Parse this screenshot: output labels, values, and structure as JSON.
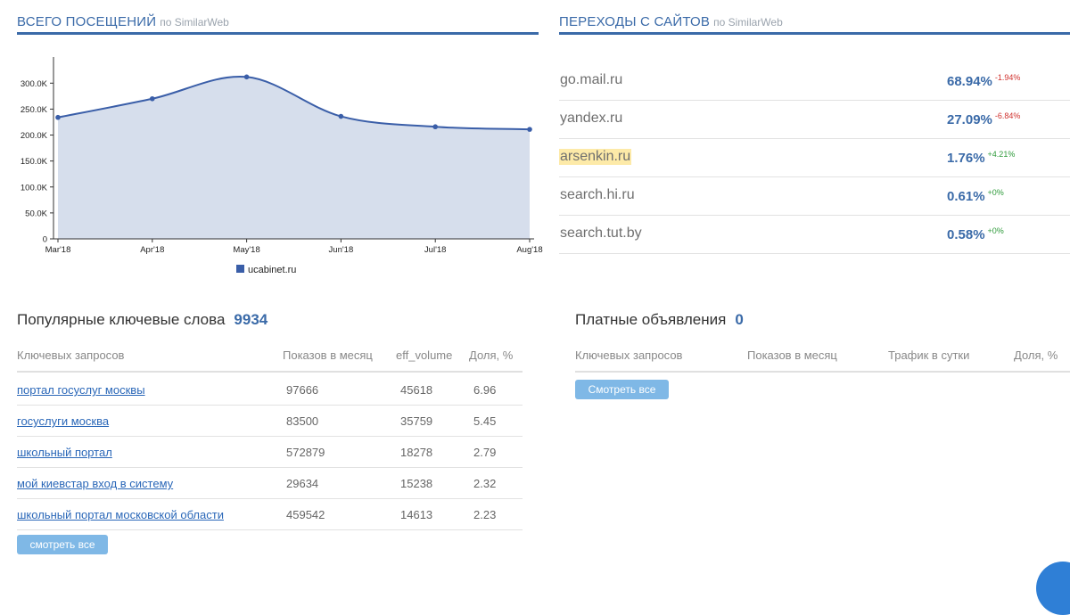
{
  "visits": {
    "title": "ВСЕГО ПОСЕЩЕНИЙ",
    "source": "по SimilarWeb",
    "legend_label": "ucabinet.ru",
    "color": "#3a5ea8"
  },
  "chart_data": {
    "type": "area",
    "x": [
      "Mar'18",
      "Apr'18",
      "May'18",
      "Jun'18",
      "Jul'18",
      "Aug'18"
    ],
    "series": [
      {
        "name": "ucabinet.ru",
        "values": [
          234000,
          270000,
          312000,
          236000,
          216000,
          211000
        ]
      }
    ],
    "y_ticks": [
      "0",
      "50.0K",
      "100.0K",
      "150.0K",
      "200.0K",
      "250.0K",
      "300.0K"
    ],
    "ylim": [
      0,
      340000
    ],
    "grid": false,
    "legend": "bottom",
    "fill_color": "#d6deec",
    "line_color": "#3a5ea8"
  },
  "referrals": {
    "title": "ПЕРЕХОДЫ С САЙТОВ",
    "source": "по SimilarWeb",
    "rows": [
      {
        "site": "go.mail.ru",
        "pct": "68.94%",
        "delta": "-1.94%",
        "trend": "neg",
        "highlight": false
      },
      {
        "site": "yandex.ru",
        "pct": "27.09%",
        "delta": "-6.84%",
        "trend": "neg",
        "highlight": false
      },
      {
        "site": "arsenkin.ru",
        "pct": "1.76%",
        "delta": "+4.21%",
        "trend": "pos",
        "highlight": true
      },
      {
        "site": "search.hi.ru",
        "pct": "0.61%",
        "delta": "+0%",
        "trend": "pos",
        "highlight": false
      },
      {
        "site": "search.tut.by",
        "pct": "0.58%",
        "delta": "+0%",
        "trend": "pos",
        "highlight": false
      }
    ]
  },
  "keywords": {
    "title": "Популярные ключевые слова",
    "count": "9934",
    "headers": [
      "Ключевых запросов",
      "Показов в месяц",
      "eff_volume",
      "Доля, %"
    ],
    "rows": [
      {
        "query": "портал госуслуг москвы",
        "shows": "97666",
        "eff": "45618",
        "share": "6.96"
      },
      {
        "query": "госуслуги москва",
        "shows": "83500",
        "eff": "35759",
        "share": "5.45"
      },
      {
        "query": "школьный портал",
        "shows": "572879",
        "eff": "18278",
        "share": "2.79"
      },
      {
        "query": "мой киевстар вход в систему",
        "shows": "29634",
        "eff": "15238",
        "share": "2.32"
      },
      {
        "query": "школьный портал московской области",
        "shows": "459542",
        "eff": "14613",
        "share": "2.23"
      }
    ],
    "button": "смотреть все"
  },
  "paid": {
    "title": "Платные объявления",
    "count": "0",
    "headers": [
      "Ключевых запросов",
      "Показов в месяц",
      "Трафик в сутки",
      "Доля, %"
    ],
    "button": "Смотреть все"
  }
}
